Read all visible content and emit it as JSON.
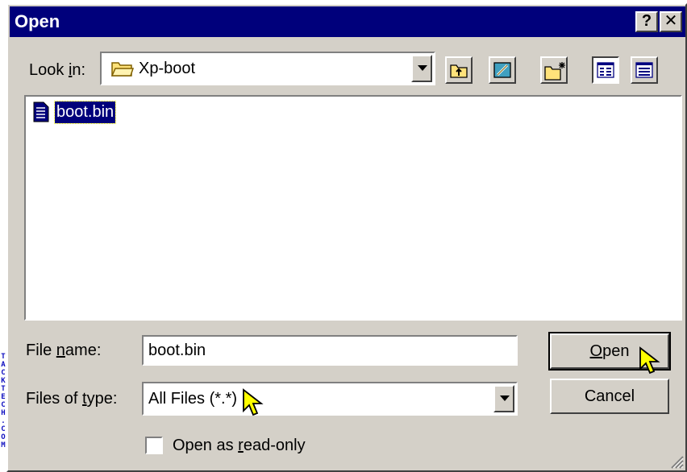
{
  "window": {
    "title": "Open"
  },
  "title_buttons": {
    "help": "?",
    "close": "✕"
  },
  "look_in": {
    "label_pre": "Look ",
    "label_accel": "i",
    "label_post": "n:",
    "value": "Xp-boot"
  },
  "toolbar": {
    "icons": [
      "up-one-level-icon",
      "desktop-icon",
      "new-folder-icon",
      "list-view-icon",
      "details-view-icon"
    ],
    "active_view": "list-view-icon"
  },
  "files": [
    {
      "name": "boot.bin",
      "icon": "document-icon",
      "selected": true
    }
  ],
  "file_name": {
    "label_pre": "File ",
    "label_accel": "n",
    "label_post": "ame:",
    "value": "boot.bin"
  },
  "file_type": {
    "label_pre": "Files of ",
    "label_accel": "t",
    "label_post": "ype:",
    "value": "All Files (*.*)"
  },
  "read_only": {
    "label_pre": "Open as ",
    "label_accel": "r",
    "label_post": "ead-only",
    "checked": false
  },
  "buttons": {
    "open_accel": "O",
    "open_rest": "pen",
    "cancel": "Cancel"
  },
  "watermark": "TACKTECH.COM",
  "colors": {
    "titlebar": "#00007b",
    "face": "#d4d0c8",
    "selection": "#00007b"
  }
}
